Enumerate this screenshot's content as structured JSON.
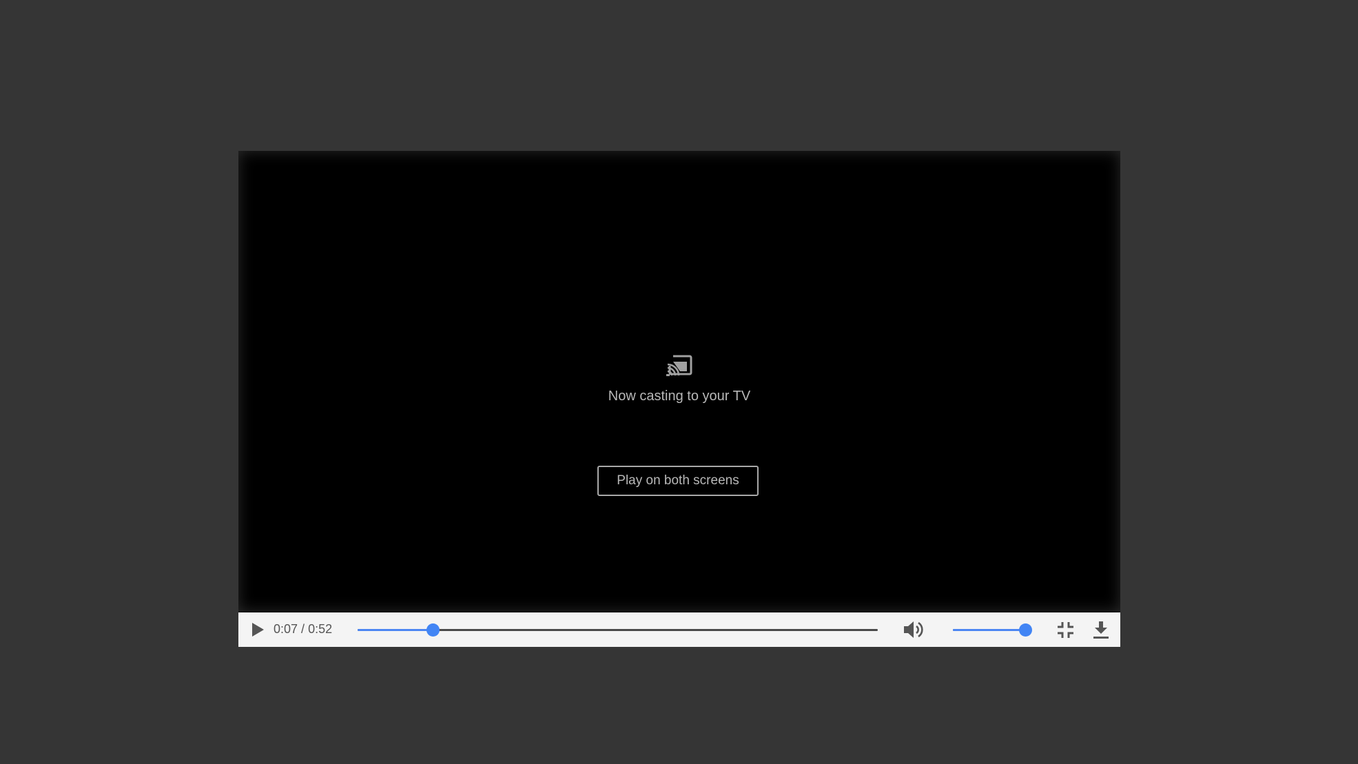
{
  "overlay": {
    "icon": "cast-icon",
    "message": "Now casting to your TV",
    "play_both_label": "Play on both screens"
  },
  "controls": {
    "play_icon": "play-icon",
    "current_time": "0:07",
    "separator": "/",
    "duration": "0:52",
    "progress_fraction": 0.145,
    "mute_icon": "volume-up-icon",
    "volume_fraction": 0.92,
    "exit_fullscreen_icon": "fullscreen-exit-icon",
    "download_icon": "download-icon"
  },
  "colors": {
    "page_background": "#353535",
    "video_background": "#000000",
    "controls_background": "#f4f4f4",
    "accent": "#4285f4",
    "track": "#4a4a4a",
    "icon": "#555555",
    "overlay_text": "#b8b8b8"
  }
}
